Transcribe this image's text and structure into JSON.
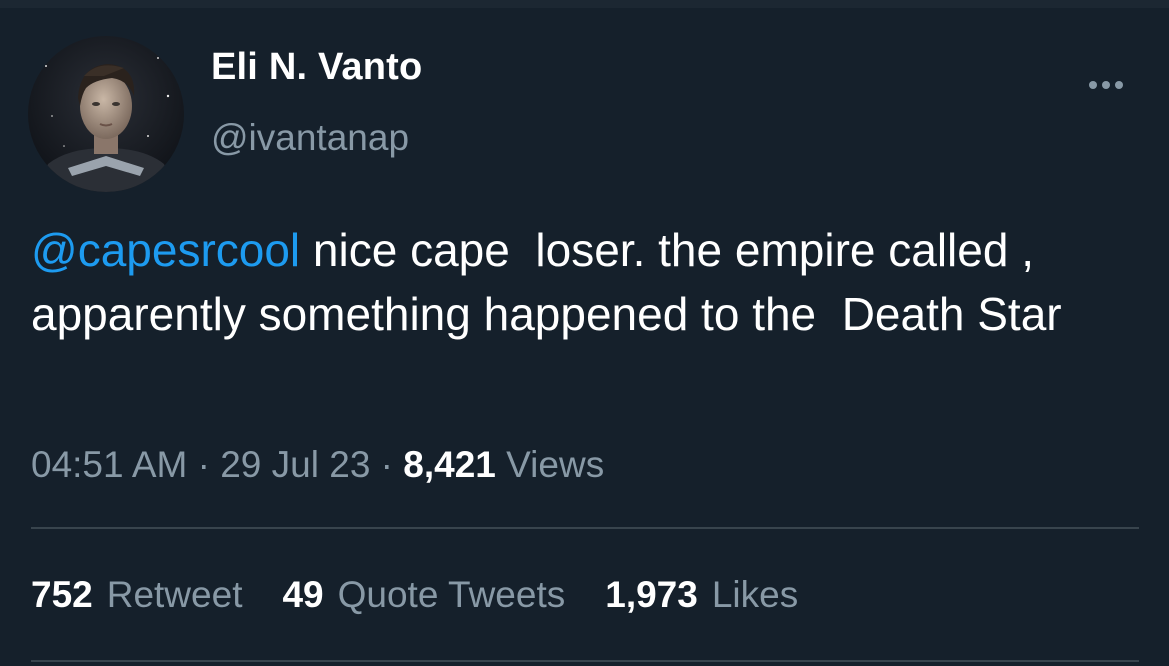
{
  "author": {
    "display_name": "Eli N. Vanto",
    "handle": "@ivantanap",
    "avatar_icon": "portrait-avatar"
  },
  "tweet": {
    "mention": "@capesrcool",
    "body": " nice cape  loser. the empire called , apparently something happened to the  Death Star"
  },
  "meta": {
    "time": "04:51 AM",
    "separator": " · ",
    "date": "29 Jul 23",
    "views_count": "8,421",
    "views_label": " Views"
  },
  "stats": {
    "retweets_count": "752",
    "retweets_label": "Retweet",
    "quotes_count": "49",
    "quotes_label": "Quote Tweets",
    "likes_count": "1,973",
    "likes_label": "Likes"
  },
  "colors": {
    "background": "#15202b",
    "mention": "#1d9bf0",
    "secondary_text": "#8899a6",
    "divider": "#38444d"
  },
  "more_icon": "more-dots-icon"
}
